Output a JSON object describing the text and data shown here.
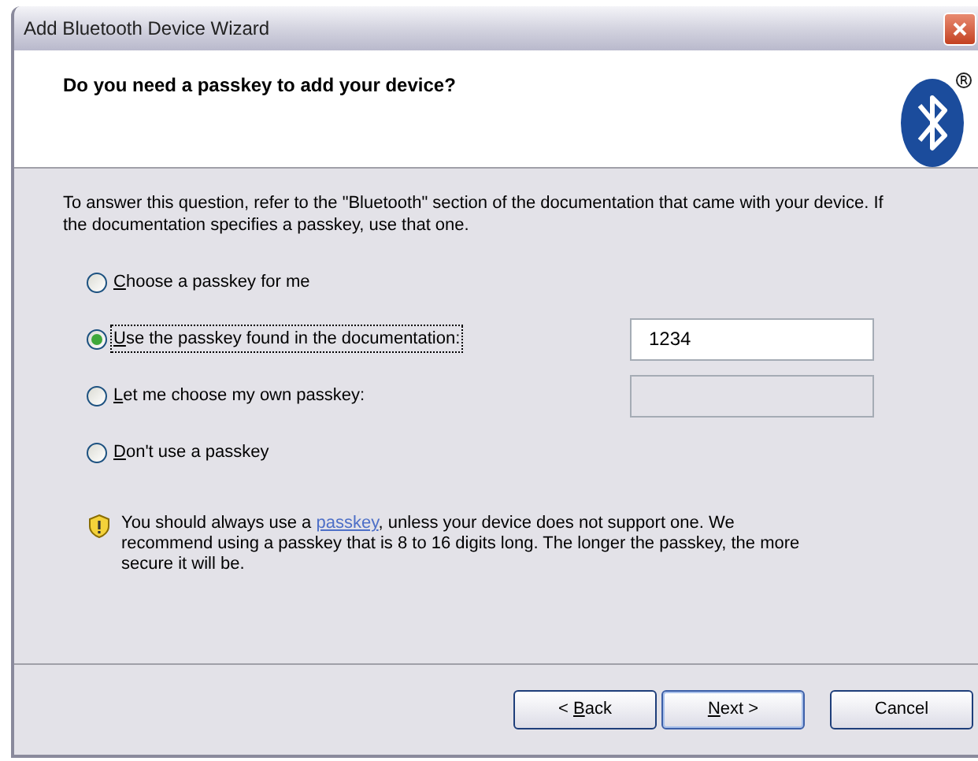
{
  "window": {
    "title": "Add Bluetooth Device Wizard"
  },
  "header": {
    "title": "Do you need a passkey to add your device?"
  },
  "intro": "To answer this question, refer to the \"Bluetooth\" section of the documentation that came with your device. If the documentation specifies a passkey, use that one.",
  "options": [
    {
      "label": {
        "key": "C",
        "after": "hoose a passkey for me"
      },
      "selected": false
    },
    {
      "label": {
        "key": "U",
        "after": "se the passkey found in the documentation:"
      },
      "selected": true,
      "field": {
        "value": "1234",
        "disabled": false
      }
    },
    {
      "label": {
        "key": "L",
        "after": "et me choose my own passkey:"
      },
      "selected": false,
      "field": {
        "disabled": true
      }
    },
    {
      "label": {
        "key": "D",
        "after": "on't use a passkey"
      },
      "selected": false
    }
  ],
  "note": {
    "before": "You should always use a ",
    "link": "passkey",
    "after": ", unless your device does not support one. We recommend using a passkey that is 8 to 16 digits long. The longer the passkey, the more secure it will be."
  },
  "buttons": [
    {
      "label": {
        "before": "< ",
        "key": "B",
        "after": "ack"
      },
      "default": false
    },
    {
      "label": {
        "key": "N",
        "after": "ext >"
      },
      "default": true
    },
    {
      "label": {
        "before": "Cancel"
      },
      "default": false
    }
  ]
}
